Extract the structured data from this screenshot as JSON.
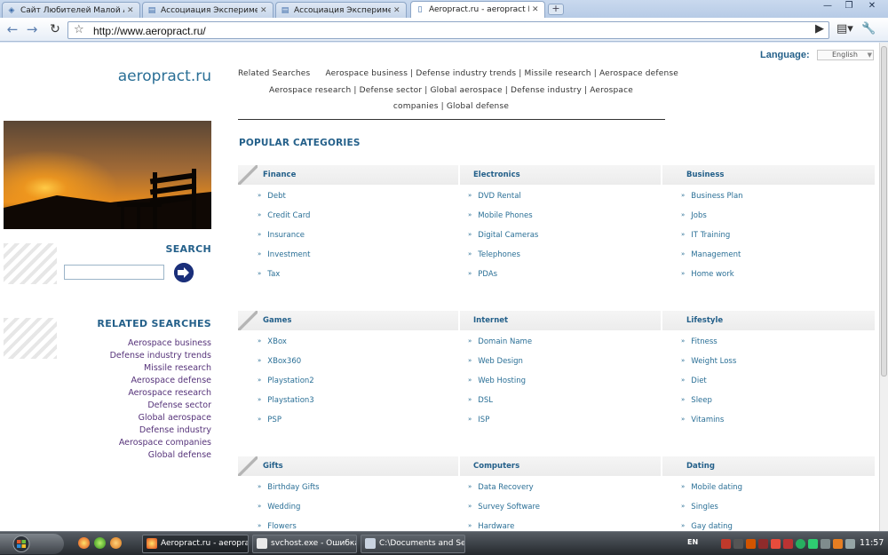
{
  "browser": {
    "tabs": [
      {
        "label": "Сайт Любителей Малой А...",
        "active": false
      },
      {
        "label": "Ассоциация Эксперимент...",
        "active": false
      },
      {
        "label": "Ассоциация Эксперимент...",
        "active": false
      },
      {
        "label": "Aeropract.ru - aeropract R...",
        "active": true
      }
    ],
    "new_tab": "+",
    "url": "http://www.aeropract.ru/",
    "window_buttons": {
      "minimize": "—",
      "maximize": "❐",
      "close": "✕"
    }
  },
  "site": {
    "logo": "aeropract.ru",
    "language": {
      "label": "Language:",
      "selected": "English"
    },
    "search": {
      "heading": "SEARCH",
      "value": ""
    },
    "related": {
      "heading": "RELATED SEARCHES",
      "title": "Related Searches",
      "items": [
        "Aerospace business",
        "Defense industry trends",
        "Missile research",
        "Aerospace defense",
        "Aerospace research",
        "Defense sector",
        "Global aerospace",
        "Defense industry",
        "Aerospace companies",
        "Global defense"
      ],
      "separator": "|"
    },
    "popular": {
      "heading": "POPULAR CATEGORIES",
      "groups": [
        {
          "name": "Finance",
          "items": [
            "Debt",
            "Credit Card",
            "Insurance",
            "Investment",
            "Tax"
          ]
        },
        {
          "name": "Electronics",
          "items": [
            "DVD Rental",
            "Mobile Phones",
            "Digital Cameras",
            "Telephones",
            "PDAs"
          ]
        },
        {
          "name": "Business",
          "items": [
            "Business Plan",
            "Jobs",
            "IT Training",
            "Management",
            "Home work"
          ]
        },
        {
          "name": "Games",
          "items": [
            "XBox",
            "XBox360",
            "Playstation2",
            "Playstation3",
            "PSP"
          ]
        },
        {
          "name": "Internet",
          "items": [
            "Domain Name",
            "Web Design",
            "Web Hosting",
            "DSL",
            "ISP"
          ]
        },
        {
          "name": "Lifestyle",
          "items": [
            "Fitness",
            "Weight Loss",
            "Diet",
            "Sleep",
            "Vitamins"
          ]
        },
        {
          "name": "Gifts",
          "items": [
            "Birthday Gifts",
            "Wedding",
            "Flowers"
          ]
        },
        {
          "name": "Computers",
          "items": [
            "Data Recovery",
            "Survey Software",
            "Hardware"
          ]
        },
        {
          "name": "Dating",
          "items": [
            "Mobile dating",
            "Singles",
            "Gay dating"
          ]
        }
      ]
    },
    "bullet": "»"
  },
  "taskbar": {
    "tasks": [
      {
        "label": "Aeropract.ru - aeropra...",
        "active": true
      },
      {
        "label": "svchost.exe - Ошибка ...",
        "active": false
      },
      {
        "label": "C:\\Documents and Sett...",
        "active": false
      }
    ],
    "language": "EN",
    "clock": "11:57"
  },
  "colors": {
    "accent": "#24608a",
    "link": "#2a6f96",
    "side_link": "#56337a"
  }
}
